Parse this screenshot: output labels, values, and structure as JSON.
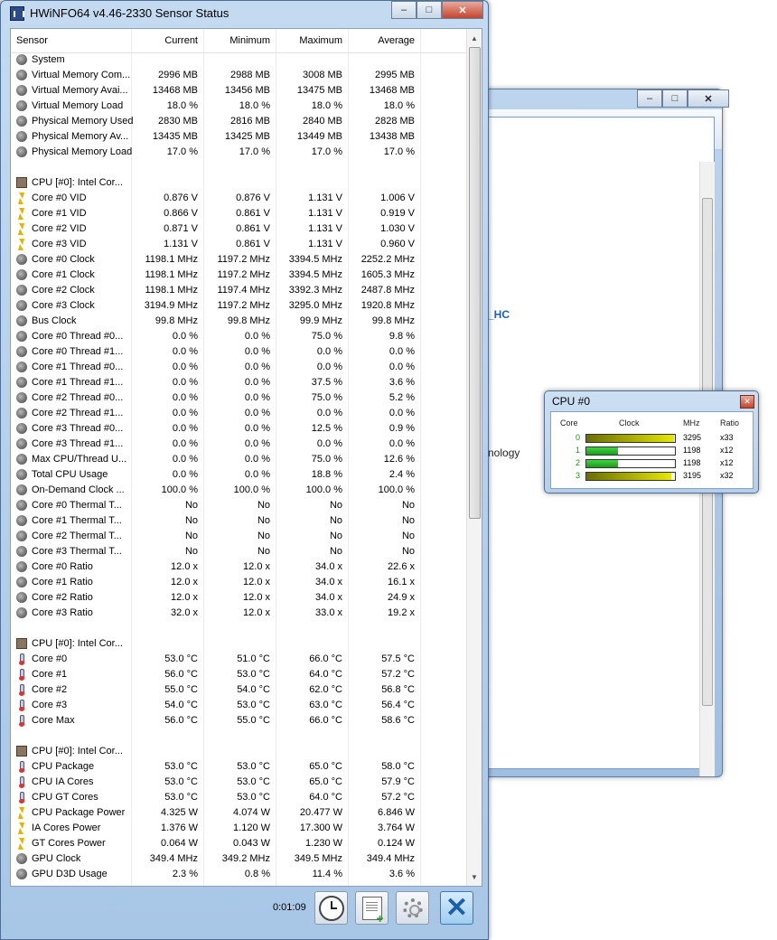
{
  "main_window": {
    "title": "HWiNFO64 v4.46-2330 Sensor Status",
    "columns": [
      "Sensor",
      "Current",
      "Minimum",
      "Maximum",
      "Average"
    ],
    "rows": [
      {
        "type": "group",
        "icon": "system-icon",
        "name": "System"
      },
      {
        "icon": "sensor-icon",
        "name": "Virtual Memory Com...",
        "cur": "2996 MB",
        "min": "2988 MB",
        "max": "3008 MB",
        "avg": "2995 MB"
      },
      {
        "icon": "sensor-icon",
        "name": "Virtual Memory Avai...",
        "cur": "13468 MB",
        "min": "13456 MB",
        "max": "13475 MB",
        "avg": "13468 MB"
      },
      {
        "icon": "sensor-icon",
        "name": "Virtual Memory Load",
        "cur": "18.0 %",
        "min": "18.0 %",
        "max": "18.0 %",
        "avg": "18.0 %"
      },
      {
        "icon": "sensor-icon",
        "name": "Physical Memory Used",
        "cur": "2830 MB",
        "min": "2816 MB",
        "max": "2840 MB",
        "avg": "2828 MB"
      },
      {
        "icon": "sensor-icon",
        "name": "Physical Memory Av...",
        "cur": "13435 MB",
        "min": "13425 MB",
        "max": "13449 MB",
        "avg": "13438 MB"
      },
      {
        "icon": "sensor-icon",
        "name": "Physical Memory Load",
        "cur": "17.0 %",
        "min": "17.0 %",
        "max": "17.0 %",
        "avg": "17.0 %"
      },
      {
        "type": "blank"
      },
      {
        "type": "group",
        "icon": "chip-icon",
        "name": "CPU [#0]: Intel Cor..."
      },
      {
        "icon": "voltage-icon",
        "name": "Core #0 VID",
        "cur": "0.876 V",
        "min": "0.876 V",
        "max": "1.131 V",
        "avg": "1.006 V"
      },
      {
        "icon": "voltage-icon",
        "name": "Core #1 VID",
        "cur": "0.866 V",
        "min": "0.861 V",
        "max": "1.131 V",
        "avg": "0.919 V"
      },
      {
        "icon": "voltage-icon",
        "name": "Core #2 VID",
        "cur": "0.871 V",
        "min": "0.861 V",
        "max": "1.131 V",
        "avg": "1.030 V"
      },
      {
        "icon": "voltage-icon",
        "name": "Core #3 VID",
        "cur": "1.131 V",
        "min": "0.861 V",
        "max": "1.131 V",
        "avg": "0.960 V"
      },
      {
        "icon": "sensor-icon",
        "name": "Core #0 Clock",
        "cur": "1198.1 MHz",
        "min": "1197.2 MHz",
        "max": "3394.5 MHz",
        "avg": "2252.2 MHz"
      },
      {
        "icon": "sensor-icon",
        "name": "Core #1 Clock",
        "cur": "1198.1 MHz",
        "min": "1197.2 MHz",
        "max": "3394.5 MHz",
        "avg": "1605.3 MHz"
      },
      {
        "icon": "sensor-icon",
        "name": "Core #2 Clock",
        "cur": "1198.1 MHz",
        "min": "1197.4 MHz",
        "max": "3392.3 MHz",
        "avg": "2487.8 MHz"
      },
      {
        "icon": "sensor-icon",
        "name": "Core #3 Clock",
        "cur": "3194.9 MHz",
        "min": "1197.2 MHz",
        "max": "3295.0 MHz",
        "avg": "1920.8 MHz"
      },
      {
        "icon": "sensor-icon",
        "name": "Bus Clock",
        "cur": "99.8 MHz",
        "min": "99.8 MHz",
        "max": "99.9 MHz",
        "avg": "99.8 MHz"
      },
      {
        "icon": "sensor-icon",
        "name": "Core #0 Thread #0...",
        "cur": "0.0 %",
        "min": "0.0 %",
        "max": "75.0 %",
        "avg": "9.8 %"
      },
      {
        "icon": "sensor-icon",
        "name": "Core #0 Thread #1...",
        "cur": "0.0 %",
        "min": "0.0 %",
        "max": "0.0 %",
        "avg": "0.0 %"
      },
      {
        "icon": "sensor-icon",
        "name": "Core #1 Thread #0...",
        "cur": "0.0 %",
        "min": "0.0 %",
        "max": "0.0 %",
        "avg": "0.0 %"
      },
      {
        "icon": "sensor-icon",
        "name": "Core #1 Thread #1...",
        "cur": "0.0 %",
        "min": "0.0 %",
        "max": "37.5 %",
        "avg": "3.6 %"
      },
      {
        "icon": "sensor-icon",
        "name": "Core #2 Thread #0...",
        "cur": "0.0 %",
        "min": "0.0 %",
        "max": "75.0 %",
        "avg": "5.2 %"
      },
      {
        "icon": "sensor-icon",
        "name": "Core #2 Thread #1...",
        "cur": "0.0 %",
        "min": "0.0 %",
        "max": "0.0 %",
        "avg": "0.0 %"
      },
      {
        "icon": "sensor-icon",
        "name": "Core #3 Thread #0...",
        "cur": "0.0 %",
        "min": "0.0 %",
        "max": "12.5 %",
        "avg": "0.9 %"
      },
      {
        "icon": "sensor-icon",
        "name": "Core #3 Thread #1...",
        "cur": "0.0 %",
        "min": "0.0 %",
        "max": "0.0 %",
        "avg": "0.0 %"
      },
      {
        "icon": "sensor-icon",
        "name": "Max CPU/Thread U...",
        "cur": "0.0 %",
        "min": "0.0 %",
        "max": "75.0 %",
        "avg": "12.6 %"
      },
      {
        "icon": "sensor-icon",
        "name": "Total CPU Usage",
        "cur": "0.0 %",
        "min": "0.0 %",
        "max": "18.8 %",
        "avg": "2.4 %"
      },
      {
        "icon": "sensor-icon",
        "name": "On-Demand Clock ...",
        "cur": "100.0 %",
        "min": "100.0 %",
        "max": "100.0 %",
        "avg": "100.0 %"
      },
      {
        "icon": "sensor-icon",
        "name": "Core #0 Thermal T...",
        "cur": "No",
        "min": "No",
        "max": "No",
        "avg": "No"
      },
      {
        "icon": "sensor-icon",
        "name": "Core #1 Thermal T...",
        "cur": "No",
        "min": "No",
        "max": "No",
        "avg": "No"
      },
      {
        "icon": "sensor-icon",
        "name": "Core #2 Thermal T...",
        "cur": "No",
        "min": "No",
        "max": "No",
        "avg": "No"
      },
      {
        "icon": "sensor-icon",
        "name": "Core #3 Thermal T...",
        "cur": "No",
        "min": "No",
        "max": "No",
        "avg": "No"
      },
      {
        "icon": "sensor-icon",
        "name": "Core #0 Ratio",
        "cur": "12.0 x",
        "min": "12.0 x",
        "max": "34.0 x",
        "avg": "22.6 x"
      },
      {
        "icon": "sensor-icon",
        "name": "Core #1 Ratio",
        "cur": "12.0 x",
        "min": "12.0 x",
        "max": "34.0 x",
        "avg": "16.1 x"
      },
      {
        "icon": "sensor-icon",
        "name": "Core #2 Ratio",
        "cur": "12.0 x",
        "min": "12.0 x",
        "max": "34.0 x",
        "avg": "24.9 x"
      },
      {
        "icon": "sensor-icon",
        "name": "Core #3 Ratio",
        "cur": "32.0 x",
        "min": "12.0 x",
        "max": "33.0 x",
        "avg": "19.2 x"
      },
      {
        "type": "blank"
      },
      {
        "type": "group",
        "icon": "chip-icon",
        "name": "CPU [#0]: Intel Cor..."
      },
      {
        "icon": "thermometer-icon",
        "name": "Core #0",
        "cur": "53.0 °C",
        "min": "51.0 °C",
        "max": "66.0 °C",
        "avg": "57.5 °C"
      },
      {
        "icon": "thermometer-icon",
        "name": "Core #1",
        "cur": "56.0 °C",
        "min": "53.0 °C",
        "max": "64.0 °C",
        "avg": "57.2 °C"
      },
      {
        "icon": "thermometer-icon",
        "name": "Core #2",
        "cur": "55.0 °C",
        "min": "54.0 °C",
        "max": "62.0 °C",
        "avg": "56.8 °C"
      },
      {
        "icon": "thermometer-icon",
        "name": "Core #3",
        "cur": "54.0 °C",
        "min": "53.0 °C",
        "max": "63.0 °C",
        "avg": "56.4 °C"
      },
      {
        "icon": "thermometer-icon",
        "name": "Core Max",
        "cur": "56.0 °C",
        "min": "55.0 °C",
        "max": "66.0 °C",
        "avg": "58.6 °C"
      },
      {
        "type": "blank"
      },
      {
        "type": "group",
        "icon": "chip-icon",
        "name": "CPU [#0]: Intel Cor..."
      },
      {
        "icon": "thermometer-icon",
        "name": "CPU Package",
        "cur": "53.0 °C",
        "min": "53.0 °C",
        "max": "65.0 °C",
        "avg": "58.0 °C"
      },
      {
        "icon": "thermometer-icon",
        "name": "CPU IA Cores",
        "cur": "53.0 °C",
        "min": "53.0 °C",
        "max": "65.0 °C",
        "avg": "57.9 °C"
      },
      {
        "icon": "thermometer-icon",
        "name": "CPU GT Cores",
        "cur": "53.0 °C",
        "min": "53.0 °C",
        "max": "64.0 °C",
        "avg": "57.2 °C"
      },
      {
        "icon": "voltage-icon",
        "name": "CPU Package Power",
        "cur": "4.325 W",
        "min": "4.074 W",
        "max": "20.477 W",
        "avg": "6.846 W"
      },
      {
        "icon": "voltage-icon",
        "name": "IA Cores Power",
        "cur": "1.376 W",
        "min": "1.120 W",
        "max": "17.300 W",
        "avg": "3.764 W"
      },
      {
        "icon": "voltage-icon",
        "name": "GT Cores Power",
        "cur": "0.064 W",
        "min": "0.043 W",
        "max": "1.230 W",
        "avg": "0.124 W"
      },
      {
        "icon": "sensor-icon",
        "name": "GPU Clock",
        "cur": "349.4 MHz",
        "min": "349.2 MHz",
        "max": "349.5 MHz",
        "avg": "349.4 MHz"
      },
      {
        "icon": "sensor-icon",
        "name": "GPU D3D Usage",
        "cur": "2.3 %",
        "min": "0.8 %",
        "max": "11.4 %",
        "avg": "3.6 %"
      }
    ],
    "elapsed_time": "0:01:09"
  },
  "background_window": {
    "text_partial_1": "_HC",
    "text_partial_2": "nology"
  },
  "cpu_popup": {
    "title": "CPU #0",
    "headers": {
      "core": "Core",
      "clock": "Clock",
      "mhz": "MHz",
      "ratio": "Ratio"
    },
    "cores": [
      {
        "id": "0",
        "mhz": "3295",
        "ratio": "x33",
        "fill": 0.99,
        "color": "yellow"
      },
      {
        "id": "1",
        "mhz": "1198",
        "ratio": "x12",
        "fill": 0.36,
        "color": "green"
      },
      {
        "id": "2",
        "mhz": "1198",
        "ratio": "x12",
        "fill": 0.36,
        "color": "green"
      },
      {
        "id": "3",
        "mhz": "3195",
        "ratio": "x32",
        "fill": 0.96,
        "color": "yellow"
      }
    ]
  },
  "colors": {
    "accent_blue": "#1d5fb8",
    "core_index_green": "#1a9a1a"
  }
}
